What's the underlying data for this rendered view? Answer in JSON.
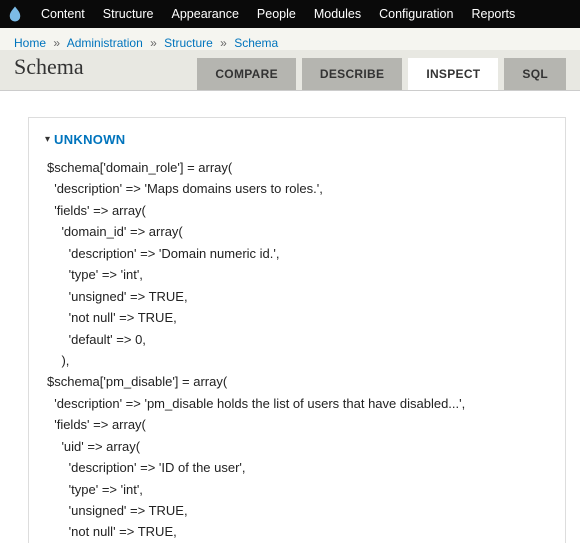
{
  "topnav": {
    "items": [
      "Content",
      "Structure",
      "Appearance",
      "People",
      "Modules",
      "Configuration",
      "Reports"
    ]
  },
  "breadcrumb": {
    "items": [
      "Home",
      "Administration",
      "Structure",
      "Schema"
    ],
    "sep": "»"
  },
  "page": {
    "title": "Schema"
  },
  "tabs": {
    "items": [
      {
        "label": "COMPARE",
        "active": false
      },
      {
        "label": "DESCRIBE",
        "active": false
      },
      {
        "label": "INSPECT",
        "active": true
      },
      {
        "label": "SQL",
        "active": false
      }
    ]
  },
  "section": {
    "label": "UNKNOWN"
  },
  "code": {
    "lines": [
      "$schema['domain_role'] = array(",
      "  'description' => 'Maps domains users to roles.',",
      "  'fields' => array(",
      "    'domain_id' => array(",
      "      'description' => 'Domain numeric id.',",
      "      'type' => 'int',",
      "      'unsigned' => TRUE,",
      "      'not null' => TRUE,",
      "      'default' => 0,",
      "    ),",
      "$schema['pm_disable'] = array(",
      "  'description' => 'pm_disable holds the list of users that have disabled...',",
      "  'fields' => array(",
      "    'uid' => array(",
      "      'description' => 'ID of the user',",
      "      'type' => 'int',",
      "      'unsigned' => TRUE,",
      "      'not null' => TRUE,"
    ]
  }
}
